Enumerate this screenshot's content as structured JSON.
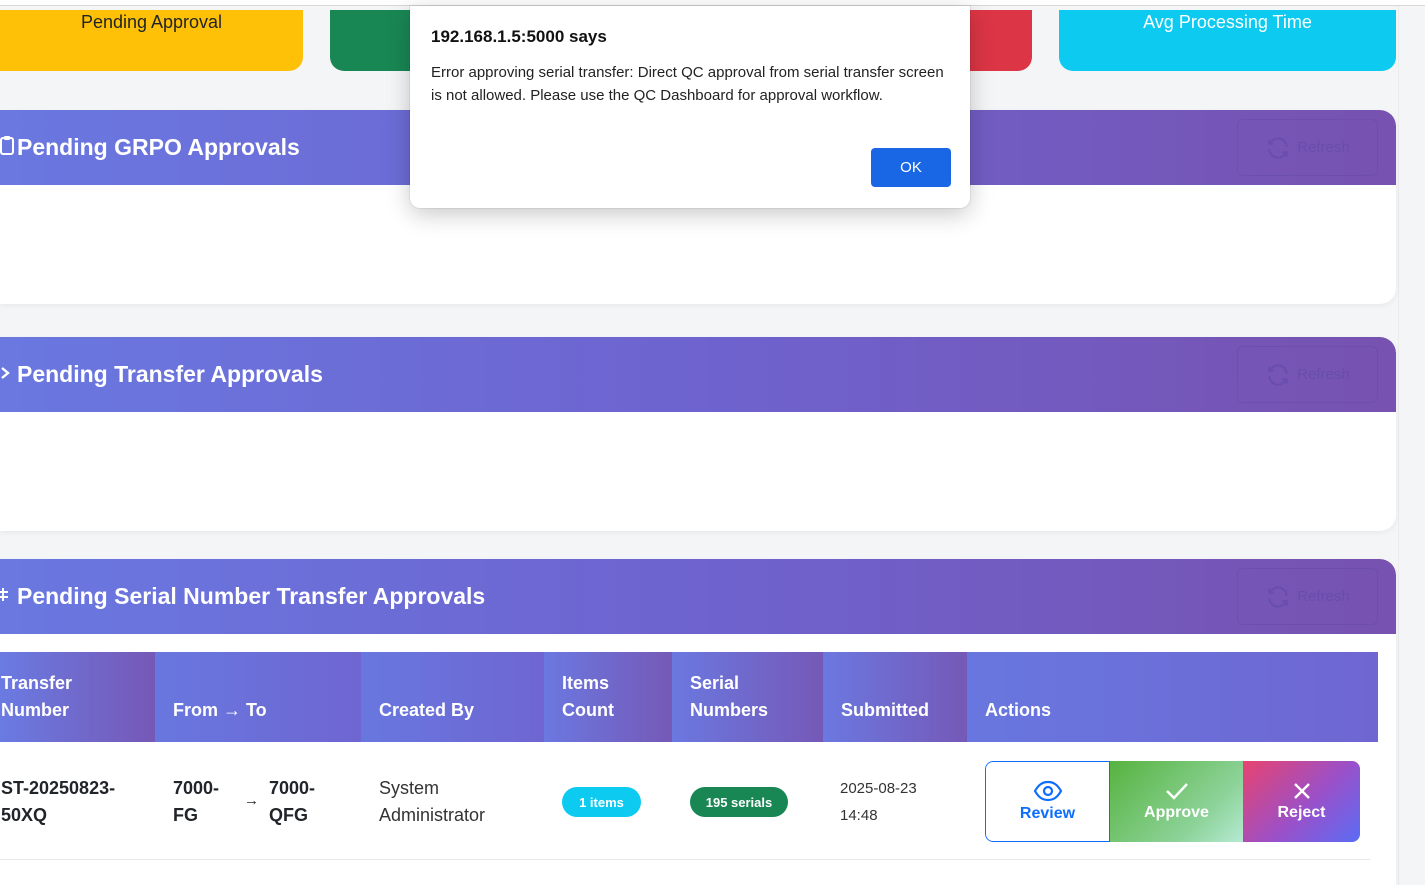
{
  "stats": {
    "pending_label": "Pending Approval",
    "avg_label": "Avg Processing Time",
    "colors": {
      "yellow": "#ffc107",
      "green": "#198754",
      "red": "#dc3545",
      "cyan": "#0dcaf0"
    }
  },
  "sections": {
    "grpo": {
      "title": "Pending GRPO Approvals",
      "icon": "clipboard-icon",
      "refresh": "Refresh"
    },
    "transfer": {
      "title": "Pending Transfer Approvals",
      "icon": "arrow-right-icon",
      "refresh": "Refresh"
    },
    "serial": {
      "title": "Pending Serial Number Transfer Approvals",
      "icon": "hash-icon",
      "refresh": "Refresh"
    }
  },
  "table": {
    "headers": [
      "Transfer\nNumber",
      "From → To",
      "Created By",
      "Items\nCount",
      "Serial\nNumbers",
      "Submitted",
      "Actions"
    ],
    "rows": [
      {
        "transfer_number": "ST-20250823-50XQ",
        "from": "7000-FG",
        "to": "7000-QFG",
        "created_by": "System Administrator",
        "items_count": "1 items",
        "serial_numbers": "195 serials",
        "submitted": "2025-08-23 14:48",
        "review": "Review",
        "approve": "Approve",
        "reject": "Reject"
      }
    ]
  },
  "dialog": {
    "title": "192.168.1.5:5000 says",
    "message": "Error approving serial transfer: Direct QC approval from serial transfer screen is not allowed. Please use the QC Dashboard for approval workflow.",
    "ok_label": "OK"
  }
}
